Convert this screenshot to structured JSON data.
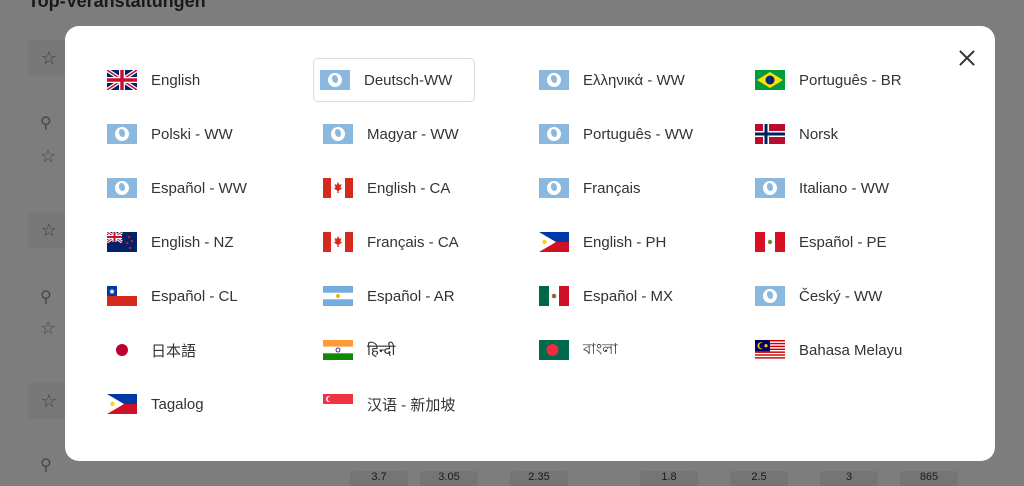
{
  "background": {
    "title": "Top-Veranstaltungen",
    "odds": [
      "3.7",
      "3.05",
      "2.35",
      "1.8",
      "2.5",
      "3",
      "865"
    ]
  },
  "modal": {
    "close_label": "",
    "languages": [
      {
        "label": "English",
        "flag": "gb",
        "selected": false
      },
      {
        "label": "Deutsch-WW",
        "flag": "globe",
        "selected": true
      },
      {
        "label": "Ελληνικά - WW",
        "flag": "globe",
        "selected": false
      },
      {
        "label": "Português - BR",
        "flag": "br",
        "selected": false
      },
      {
        "label": "Polski - WW",
        "flag": "globe",
        "selected": false
      },
      {
        "label": "Magyar - WW",
        "flag": "globe",
        "selected": false
      },
      {
        "label": "Português - WW",
        "flag": "globe",
        "selected": false
      },
      {
        "label": "Norsk",
        "flag": "no",
        "selected": false
      },
      {
        "label": "Español - WW",
        "flag": "globe",
        "selected": false
      },
      {
        "label": "English - CA",
        "flag": "ca",
        "selected": false
      },
      {
        "label": "Français",
        "flag": "globe",
        "selected": false
      },
      {
        "label": "Italiano - WW",
        "flag": "globe",
        "selected": false
      },
      {
        "label": "English - NZ",
        "flag": "nz",
        "selected": false
      },
      {
        "label": "Français - CA",
        "flag": "ca",
        "selected": false
      },
      {
        "label": "English - PH",
        "flag": "ph",
        "selected": false
      },
      {
        "label": "Español - PE",
        "flag": "pe",
        "selected": false
      },
      {
        "label": "Español - CL",
        "flag": "cl",
        "selected": false
      },
      {
        "label": "Español - AR",
        "flag": "ar",
        "selected": false
      },
      {
        "label": "Español - MX",
        "flag": "mx",
        "selected": false
      },
      {
        "label": "Český - WW",
        "flag": "globe",
        "selected": false
      },
      {
        "label": "日本語",
        "flag": "jp",
        "selected": false
      },
      {
        "label": "हिन्दी",
        "flag": "in",
        "selected": false
      },
      {
        "label": "বাংলা",
        "flag": "bd",
        "selected": false
      },
      {
        "label": "Bahasa Melayu",
        "flag": "my",
        "selected": false
      },
      {
        "label": "Tagalog",
        "flag": "ph",
        "selected": false
      },
      {
        "label": "汉语 - 新加坡",
        "flag": "sg",
        "selected": false
      }
    ]
  }
}
